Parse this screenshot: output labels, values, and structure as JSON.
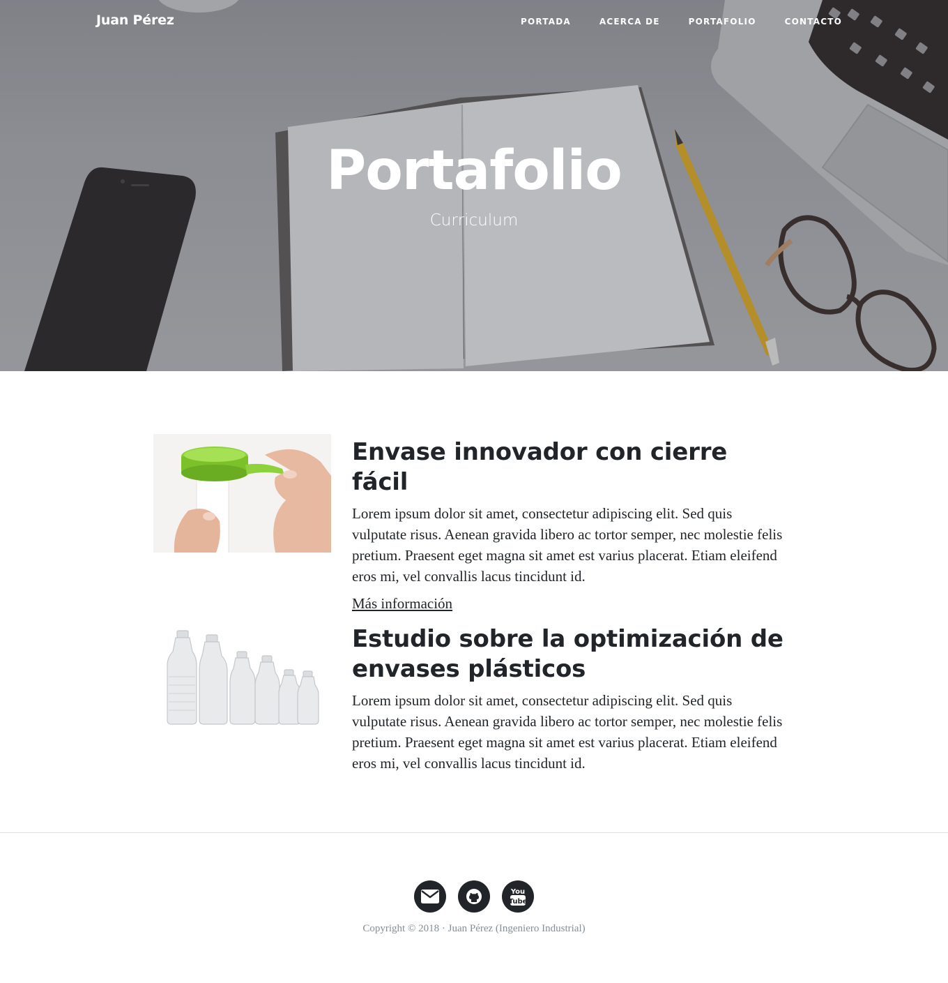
{
  "navbar": {
    "brand": "Juan Pérez",
    "links": [
      {
        "label": "PORTADA"
      },
      {
        "label": "ACERCA DE"
      },
      {
        "label": "PORTAFOLIO"
      },
      {
        "label": "CONTACTO"
      }
    ]
  },
  "hero": {
    "title": "Portafolio",
    "subtitle": "Curriculum"
  },
  "portfolio": {
    "items": [
      {
        "title": "Envase innovador con cierre fácil",
        "text": "Lorem ipsum dolor sit amet, consectetur adipiscing elit. Sed quis vulputate risus. Aenean gravida libero ac tortor semper, nec molestie felis pretium. Praesent eget magna sit amet est varius placerat. Etiam eleifend eros mi, vel convallis lacus tincidunt id.",
        "link": "Más información"
      },
      {
        "title": "Estudio sobre la optimización de envases plásticos",
        "text": "Lorem ipsum dolor sit amet, consectetur adipiscing elit. Sed quis vulputate risus. Aenean gravida libero ac tortor semper, nec molestie felis pretium. Praesent eget magna sit amet est varius placerat. Etiam eleifend eros mi, vel convallis lacus tincidunt id."
      }
    ]
  },
  "footer": {
    "social": [
      {
        "icon": "envelope-icon"
      },
      {
        "icon": "github-icon"
      },
      {
        "icon": "youtube-icon",
        "label": "You Tube"
      }
    ],
    "copyright": "Copyright © 2018 · Juan Pérez (Ingeniero Industrial)"
  },
  "colors": {
    "text": "#212529",
    "muted": "#868e96",
    "accent_green": "#8fd13a"
  }
}
